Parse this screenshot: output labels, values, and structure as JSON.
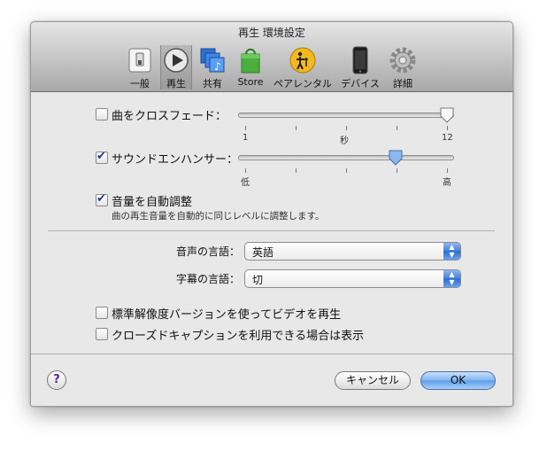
{
  "window": {
    "title": "再生 環境設定"
  },
  "toolbar": {
    "tabs": [
      {
        "label": "一般",
        "icon": "switch-icon"
      },
      {
        "label": "再生",
        "icon": "play-icon",
        "selected": true
      },
      {
        "label": "共有",
        "icon": "sharing-icon"
      },
      {
        "label": "Store",
        "icon": "store-bag-icon"
      },
      {
        "label": "ペアレンタル",
        "icon": "parental-icon"
      },
      {
        "label": "デバイス",
        "icon": "iphone-icon"
      },
      {
        "label": "詳細",
        "icon": "gear-icon"
      }
    ]
  },
  "crossfade": {
    "label": "曲をクロスフェード：",
    "checked": false,
    "value": 12,
    "min_label": "1",
    "mid_label": "秒",
    "max_label": "12"
  },
  "enhancer": {
    "label": "サウンドエンハンサー：",
    "checked": true,
    "level": 0.73,
    "low_label": "低",
    "high_label": "高"
  },
  "volume": {
    "label": "音量を自動調整",
    "checked": true,
    "description": "曲の再生音量を自動的に同じレベルに調整します。"
  },
  "audio_language": {
    "label": "音声の言語：",
    "value": "英語"
  },
  "subtitle_language": {
    "label": "字幕の言語：",
    "value": "切"
  },
  "options": {
    "sd_video": {
      "label": "標準解像度バージョンを使ってビデオを再生",
      "checked": false
    },
    "closed_captions": {
      "label": "クローズドキャプションを利用できる場合は表示",
      "checked": false
    }
  },
  "buttons": {
    "help": "?",
    "cancel": "キャンセル",
    "ok": "OK"
  },
  "colors": {
    "accent": "#3f7fda",
    "checkmark": "#1a3a8a",
    "help": "#5a2d91"
  }
}
